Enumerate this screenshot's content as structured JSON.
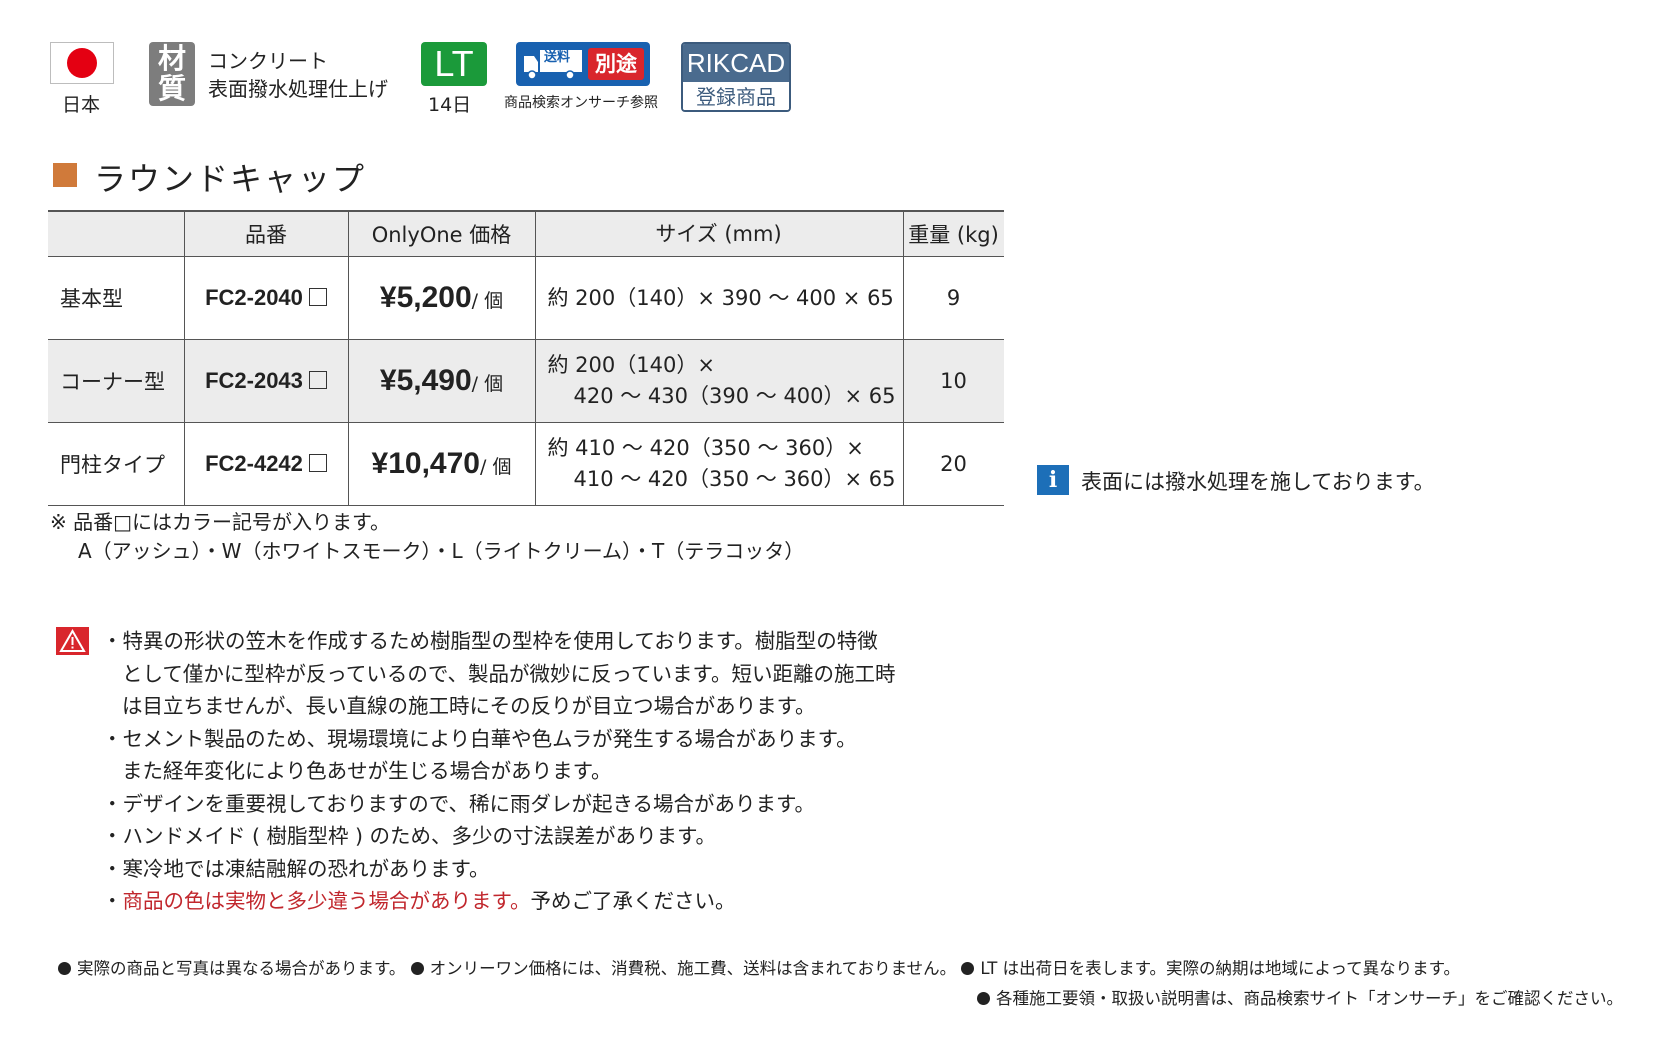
{
  "header": {
    "origin_label": "日本",
    "material_icon": "材質",
    "material_text": [
      "コンクリート",
      "表面撥水処理仕上げ"
    ],
    "lt_badge": "LT",
    "lt_days": "14日",
    "shipping_tag": "送料",
    "shipping_badge": "別途",
    "shipping_note": "商品検索オンサーチ参照",
    "rikcad_top": "RIKCAD",
    "rikcad_bottom": "登録商品"
  },
  "section_title": "ラウンドキャップ",
  "table": {
    "headers": [
      "",
      "品番",
      "OnlyOne 価格",
      "サイズ (mm)",
      "重量 (kg)"
    ],
    "rows": [
      {
        "type": "基本型",
        "code": "FC2-2040",
        "price": "¥5,200",
        "unit": "/ 個",
        "size1": "約 200（140）× 390 ～ 400 × 65",
        "size2": "",
        "weight": "9"
      },
      {
        "type": "コーナー型",
        "code": "FC2-2043",
        "price": "¥5,490",
        "unit": "/ 個",
        "size1": "約 200（140）×",
        "size2": "420 ～ 430（390 ～ 400）× 65",
        "weight": "10"
      },
      {
        "type": "門柱タイプ",
        "code": "FC2-4242",
        "price": "¥10,470",
        "unit": "/ 個",
        "size1": "約 410 ～ 420（350 ～ 360）×",
        "size2": "410 ～ 420（350 ～ 360）× 65",
        "weight": "20"
      }
    ]
  },
  "color_note": [
    "※ 品番□にはカラー記号が入ります。",
    "A（アッシュ）・W（ホワイトスモーク）・L（ライトクリーム）・T（テラコッタ）"
  ],
  "info_text": "表面には撥水処理を施しております。",
  "warnings": [
    {
      "lines": [
        "・特異の形状の笠木を作成するため樹脂型の型枠を使用しております。樹脂型の特徴",
        "として僅かに型枠が反っているので、製品が微妙に反っています。短い距離の施工時",
        "は目立ちませんが、長い直線の施工時にその反りが目立つ場合があります。"
      ]
    },
    {
      "lines": [
        "・セメント製品のため、現場環境により白華や色ムラが発生する場合があります。",
        "また経年変化により色あせが生じる場合があります。"
      ]
    },
    {
      "lines": [
        "・デザインを重要視しておりますので、稀に雨ダレが起きる場合があります。"
      ]
    },
    {
      "lines": [
        "・ハンドメイド ( 樹脂型枠 ) のため、多少の寸法誤差があります。"
      ]
    },
    {
      "lines": [
        "・寒冷地では凍結融解の恐れがあります。"
      ]
    }
  ],
  "warning_last": {
    "bullet": "・",
    "red": "商品の色は実物と多少違う場合があります。",
    "rest": "予めご了承ください。"
  },
  "footer": [
    "実際の商品と写真は異なる場合があります。",
    "オンリーワン価格には、消費税、施工費、送料は含まれておりません。",
    "LT は出荷日を表します。実際の納期は地域によって異なります。",
    "各種施工要領・取扱い説明書は、商品検索サイト「オンサーチ」をご確認ください。"
  ],
  "colors": {
    "accent_square": "#d07a3a",
    "lt_green": "#1b9a3a",
    "shipping_blue": "#1861b0",
    "warning_red": "#d9262c",
    "info_blue": "#1d6fb8"
  }
}
